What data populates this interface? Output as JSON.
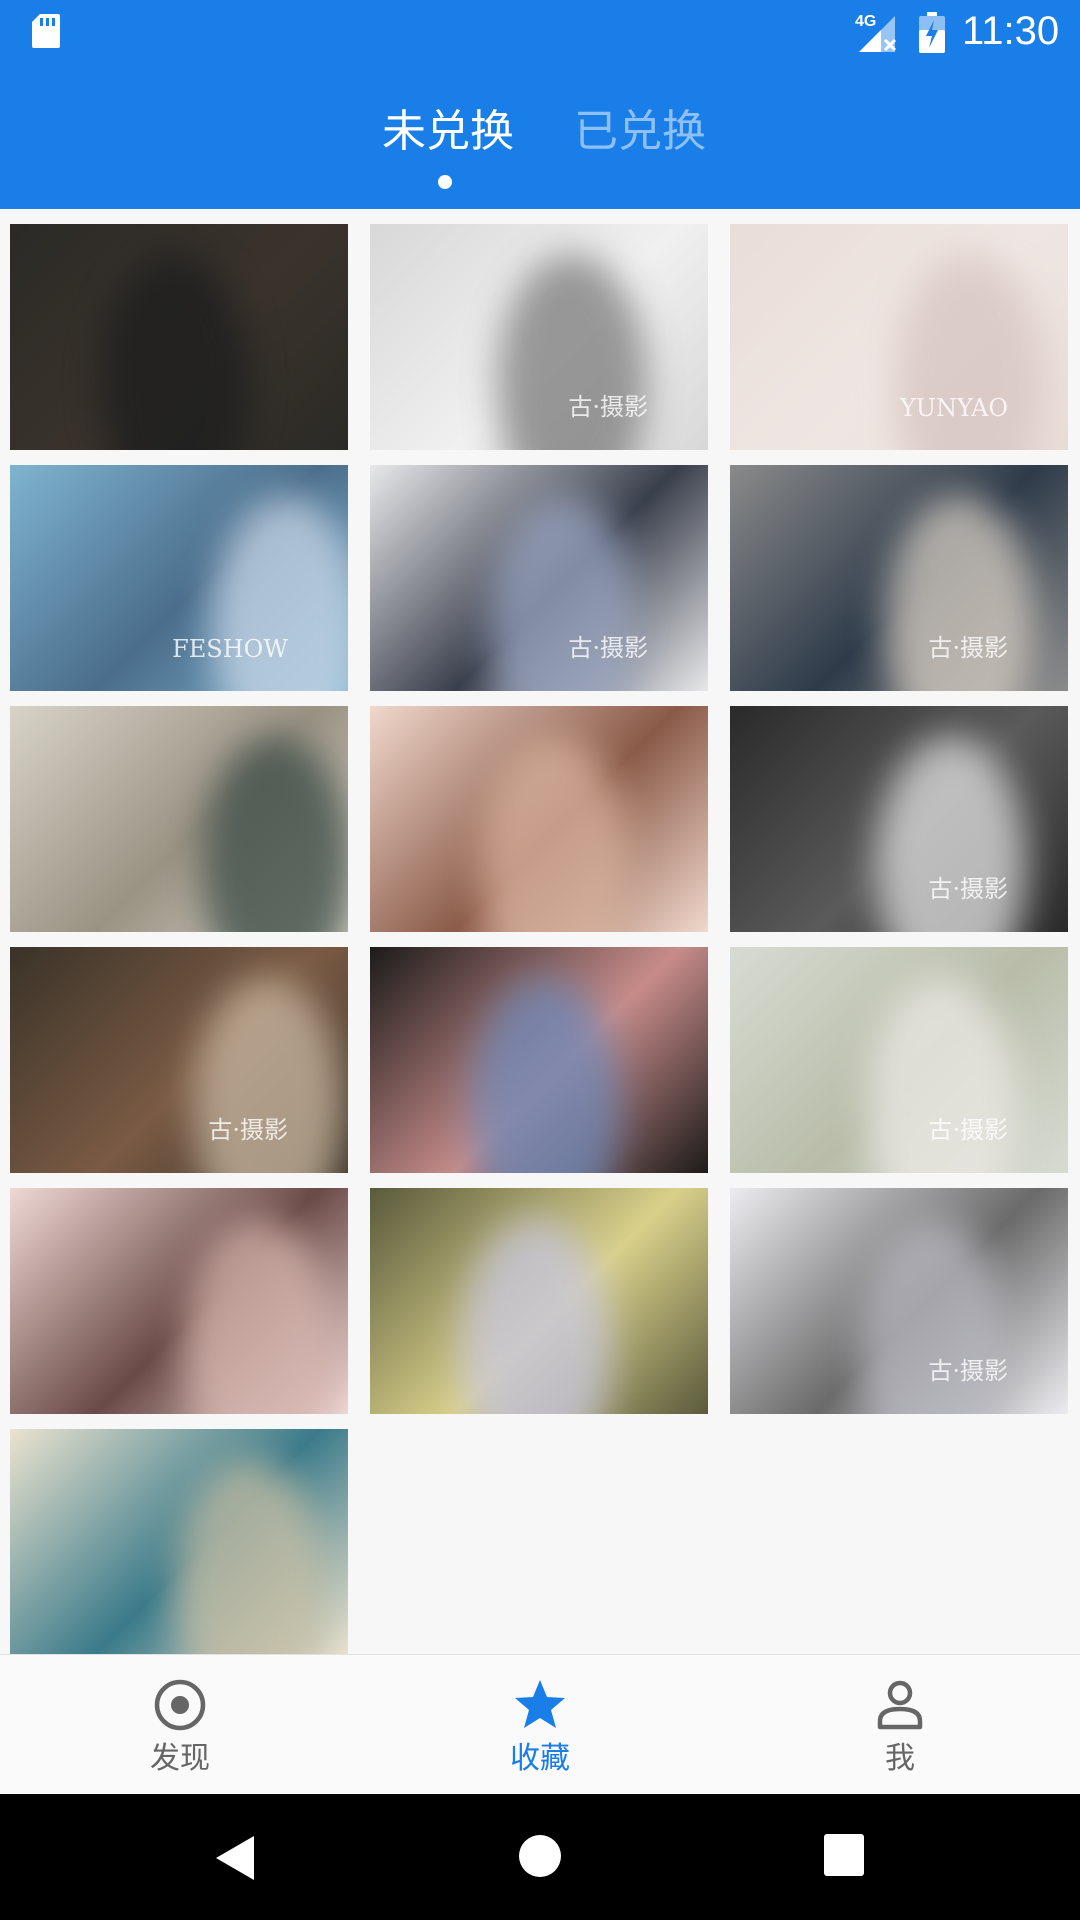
{
  "status_bar": {
    "time": "11:30",
    "network": "4G",
    "icons": [
      "sd-card-icon",
      "signal-icon",
      "battery-charging-icon"
    ]
  },
  "tabs": [
    {
      "label": "未兑换",
      "active": true
    },
    {
      "label": "已兑换",
      "active": false
    }
  ],
  "photos": [
    {
      "name": "photo-1",
      "colors": [
        "#2b2a26",
        "#1c1d1e",
        "#3a332c"
      ]
    },
    {
      "name": "photo-2",
      "colors": [
        "#d8d8d8",
        "#7a7a7a",
        "#f0f0f0"
      ],
      "caption": "古·摄影"
    },
    {
      "name": "photo-3",
      "colors": [
        "#e9ddd8",
        "#d6c4c0",
        "#efe6e3"
      ],
      "caption": "YUNYAO"
    },
    {
      "name": "photo-4",
      "colors": [
        "#7fb4cf",
        "#c9d7e8",
        "#4a6d8b"
      ],
      "caption": "FESHOW"
    },
    {
      "name": "photo-5",
      "colors": [
        "#e8e8ea",
        "#9aa6c0",
        "#3a3f4c"
      ],
      "caption": "古·摄影"
    },
    {
      "name": "photo-6",
      "colors": [
        "#8a8a8a",
        "#d8cfc4",
        "#2e3b4a"
      ],
      "caption": "古·摄影"
    },
    {
      "name": "photo-7",
      "colors": [
        "#d8d3c8",
        "#3a4a45",
        "#9a9384"
      ]
    },
    {
      "name": "photo-8",
      "colors": [
        "#f0d8cc",
        "#d9b39f",
        "#8a5a48"
      ]
    },
    {
      "name": "photo-9",
      "colors": [
        "#2a2a2a",
        "#e0e0e0",
        "#5a5a5a"
      ],
      "caption": "古·摄影"
    },
    {
      "name": "photo-10",
      "colors": [
        "#3a3328",
        "#c9b8a2",
        "#7a5a44"
      ],
      "caption": "古·摄影"
    },
    {
      "name": "photo-11",
      "colors": [
        "#1c1b1a",
        "#6c88b8",
        "#c78c8a"
      ]
    },
    {
      "name": "photo-12",
      "colors": [
        "#d8dbd2",
        "#eceae6",
        "#b8bca8"
      ],
      "caption": "古·摄影"
    },
    {
      "name": "photo-13",
      "colors": [
        "#efd9d5",
        "#d9b7b0",
        "#6a4a46"
      ]
    },
    {
      "name": "photo-14",
      "colors": [
        "#5a5a3c",
        "#c7c6e0",
        "#d9d08a"
      ]
    },
    {
      "name": "photo-15",
      "colors": [
        "#ececf0",
        "#b8b8c0",
        "#6a6a6a"
      ],
      "caption": "古·摄影"
    },
    {
      "name": "photo-16",
      "colors": [
        "#ebe3cf",
        "#c9bfa4",
        "#3a7a8a"
      ]
    }
  ],
  "bottom_nav": [
    {
      "label": "发现",
      "icon": "discover-icon",
      "active": false
    },
    {
      "label": "收藏",
      "icon": "star-icon",
      "active": true
    },
    {
      "label": "我",
      "icon": "person-icon",
      "active": false
    }
  ],
  "system_nav": [
    "back-icon",
    "home-icon",
    "recents-icon"
  ],
  "theme": {
    "primary": "#1a7ee8",
    "inactive_tab": "#8ec0f5",
    "nav_inactive": "#666666"
  }
}
